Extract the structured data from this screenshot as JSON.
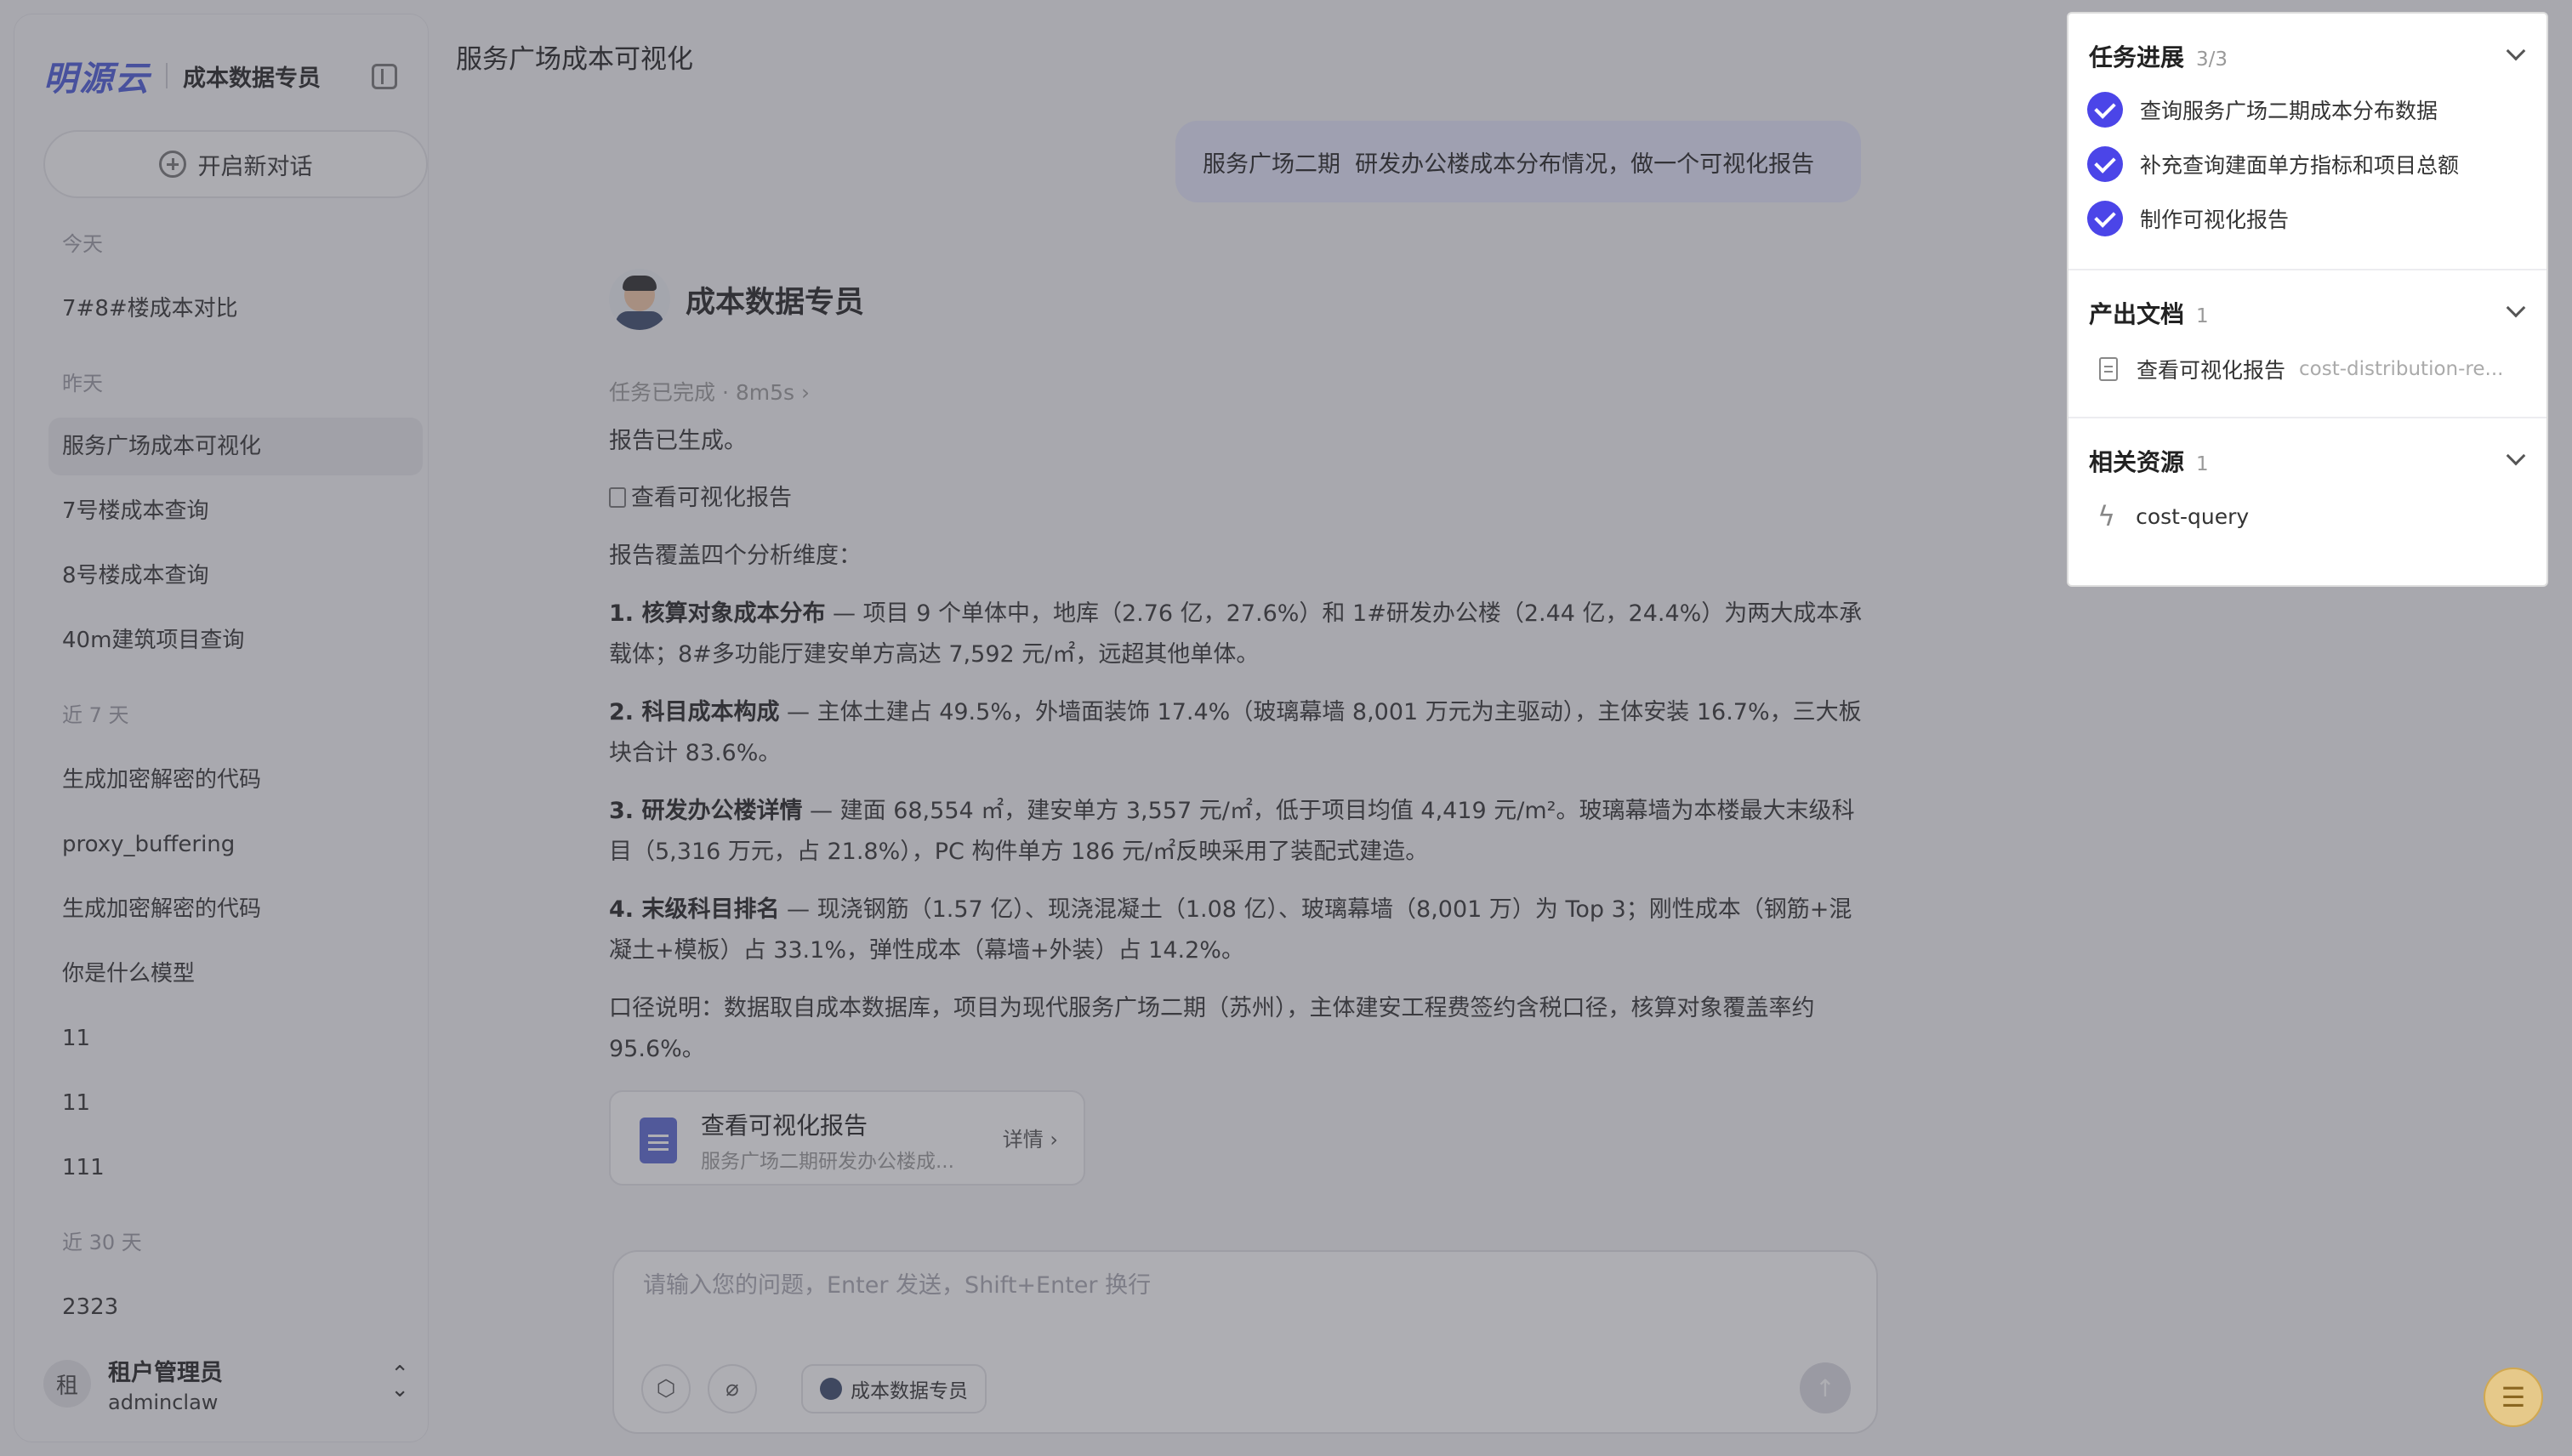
{
  "sidebar": {
    "brand_logo": "明源云",
    "brand_name": "成本数据专员",
    "new_chat_label": "开启新对话",
    "groups": {
      "today": "今天",
      "yesterday": "昨天",
      "week": "近 7 天",
      "month": "近 30 天"
    },
    "items": [
      "7#8#楼成本对比",
      "服务广场成本可视化",
      "7号楼成本查询",
      "8号楼成本查询",
      "40m建筑项目查询",
      "生成加密解密的代码",
      "proxy_buffering",
      "生成加密解密的代码",
      "你是什么模型",
      "11",
      "11",
      "111",
      "2323"
    ],
    "user": {
      "avatar_char": "租",
      "name": "租户管理员",
      "sub": "adminclaw"
    }
  },
  "main": {
    "title": "服务广场成本可视化",
    "user_message": "服务广场二期  研发办公楼成本分布情况，做一个可视化报告",
    "agent_name": "成本数据专员",
    "task_status": "任务已完成 · 8m5s",
    "line_generated": "报告已生成。",
    "link_report": "查看可视化报告",
    "line_covers": "报告覆盖四个分析维度：",
    "points": [
      {
        "title": "1. 核算对象成本分布",
        "line1": " — 项目 9 个单体中，地库（2.76 亿，27.6%）和 1#研发办公楼（2.44 亿，24.4%）为两大成本承",
        "line2": "载体；8#多功能厅建安单方高达 7,592 元/㎡，远超其他单体。"
      },
      {
        "title": "2. 科目成本构成",
        "line1": " — 主体土建占 49.5%，外墙面装饰 17.4%（玻璃幕墙 8,001 万元为主驱动），主体安装 16.7%，三大板",
        "line2": "块合计 83.6%。"
      },
      {
        "title": "3. 研发办公楼详情",
        "line1": " — 建面 68,554 ㎡，建安单方 3,557 元/㎡，低于项目均值 4,419 元/m²。玻璃幕墙为本楼最大末级科",
        "line2": "目（5,316 万元，占 21.8%），PC 构件单方 186 元/㎡反映采用了装配式建造。"
      },
      {
        "title": "4. 末级科目排名",
        "line1": " — 现浇钢筋（1.57 亿）、现浇混凝土（1.08 亿）、玻璃幕墙（8,001 万）为 Top 3；刚性成本（钢筋+混",
        "line2": "凝土+模板）占 33.1%，弹性成本（幕墙+外装）占 14.2%。"
      }
    ],
    "note_line1": "口径说明：数据取自成本数据库，项目为现代服务广场二期（苏州），主体建安工程费签约含税口径，核算对象覆盖率约",
    "note_line2": "95.6%。",
    "report_card": {
      "title": "查看可视化报告",
      "subtitle": "服务广场二期研发办公楼成...",
      "detail": "详情 ›"
    },
    "input": {
      "placeholder": "请输入您的问题，Enter 发送，Shift+Enter 换行",
      "agent_chip": "成本数据专员"
    }
  },
  "panel": {
    "progress": {
      "title": "任务进展",
      "count": "3/3",
      "tasks": [
        "查询服务广场二期成本分布数据",
        "补充查询建面单方指标和项目总额",
        "制作可视化报告"
      ]
    },
    "outputs": {
      "title": "产出文档",
      "count": "1",
      "file_name": "查看可视化报告",
      "file_path": "cost-distribution-re..."
    },
    "resources": {
      "title": "相关资源",
      "count": "1",
      "item": "cost-query"
    }
  },
  "colors": {
    "accent": "#4b45e8",
    "brand": "#4a5ad8",
    "user_bubble": "#e4e6fb"
  }
}
